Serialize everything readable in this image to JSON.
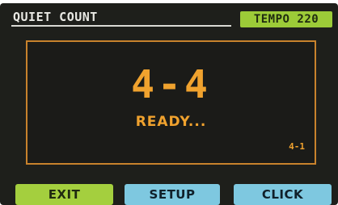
{
  "header": {
    "title": "QUIET COUNT",
    "tempo": "TEMPO 220"
  },
  "display": {
    "meter": "4-4",
    "status": "READY...",
    "counter": "4-1"
  },
  "buttons": {
    "exit": "EXIT",
    "setup": "SETUP",
    "click": "CLICK"
  },
  "colors": {
    "background": "#1e1f1b",
    "accent_orange": "#f0a22e",
    "tempo_green": "#9ccb38",
    "button_green": "#a4cf3e",
    "button_blue": "#7ec8e0"
  }
}
